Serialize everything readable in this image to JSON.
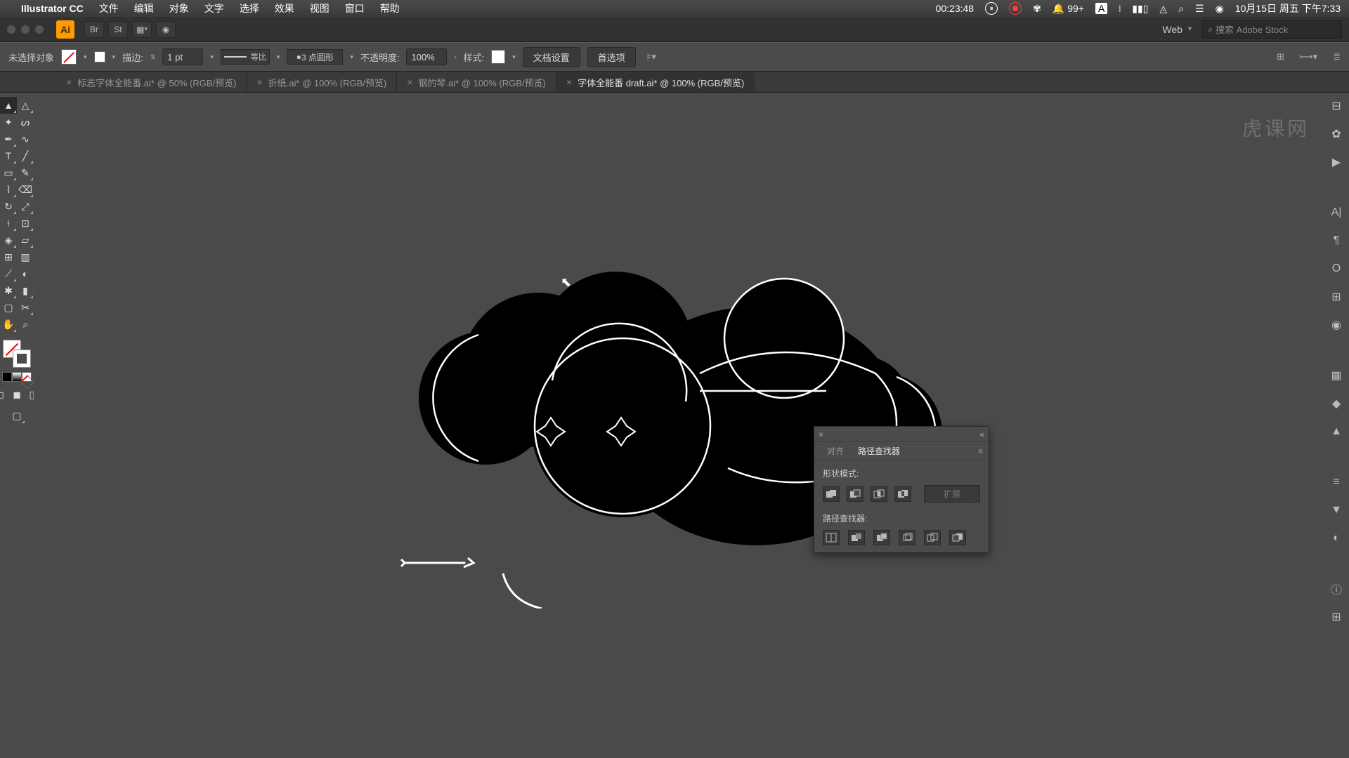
{
  "menubar": {
    "app_name": "Illustrator CC",
    "items": [
      "文件",
      "编辑",
      "对象",
      "文字",
      "选择",
      "效果",
      "视图",
      "窗口",
      "帮助"
    ],
    "timer": "00:23:48",
    "notif_badge": "99+",
    "input_ind": "A",
    "datetime": "10月15日 周五 下午7:33"
  },
  "header": {
    "doc_profile": "Web",
    "search_placeholder": "搜索 Adobe Stock"
  },
  "control": {
    "selection": "未选择对象",
    "stroke_label": "描边:",
    "stroke_weight": "1 pt",
    "brush_mode": "等比",
    "profile": "3 点圆形",
    "opacity_label": "不透明度:",
    "opacity": "100%",
    "style_label": "样式:",
    "doc_setup": "文档设置",
    "prefs": "首选项"
  },
  "tabs": [
    {
      "label": "标志字体全能番.ai* @ 50% (RGB/预览)",
      "active": false
    },
    {
      "label": "折纸.ai* @ 100% (RGB/预览)",
      "active": false
    },
    {
      "label": "钢的琴.ai* @ 100% (RGB/预览)",
      "active": false
    },
    {
      "label": "字体全能番 draft.ai* @ 100% (RGB/预览)",
      "active": true
    }
  ],
  "panel": {
    "tab_align": "对齐",
    "tab_pathfinder": "路径查找器",
    "shape_modes_label": "形状模式:",
    "expand": "扩展",
    "pathfinders_label": "路径查找器:"
  },
  "watermark": "虎课网"
}
